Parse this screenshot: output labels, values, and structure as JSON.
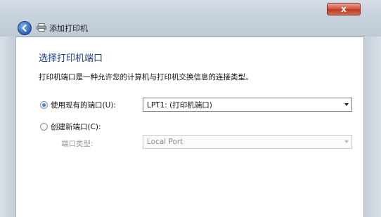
{
  "window": {
    "title": "添加打印机",
    "close_label": "x"
  },
  "page": {
    "heading": "选择打印机端口",
    "description": "打印机端口是一种允许您的计算机与打印机交换信息的连接类型。"
  },
  "options": {
    "use_existing": {
      "label": "使用现有的端口(U):",
      "selected": true,
      "value": "LPT1: (打印机端口)"
    },
    "create_new": {
      "label": "创建新端口(C):",
      "selected": false
    },
    "port_type": {
      "label": "端口类型:",
      "value": "Local Port",
      "enabled": false
    }
  }
}
